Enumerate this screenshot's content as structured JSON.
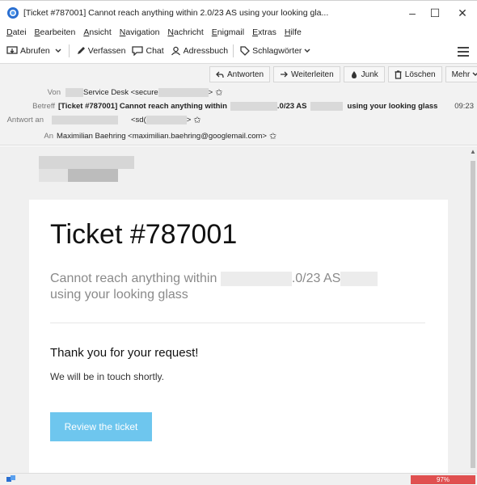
{
  "window": {
    "title": "[Ticket #787001] Cannot reach anything within           2.0/23 AS           using your looking gla...",
    "minimize": "–",
    "maximize": "☐",
    "close": "✕"
  },
  "menu": [
    "Datei",
    "Bearbeiten",
    "Ansicht",
    "Navigation",
    "Nachricht",
    "Enigmail",
    "Extras",
    "Hilfe"
  ],
  "toolbar": {
    "abrufen": "Abrufen",
    "verfassen": "Verfassen",
    "chat": "Chat",
    "adressbuch": "Adressbuch",
    "schlagwoerter": "Schlagwörter"
  },
  "actions": {
    "antworten": "Antworten",
    "weiterleiten": "Weiterleiten",
    "junk": "Junk",
    "loeschen": "Löschen",
    "mehr": "Mehr"
  },
  "headers": {
    "from_label": "Von",
    "from_value_a": "Service Desk <secure",
    "from_value_b": ">",
    "subject_label": "Betreff",
    "subject_a": "[Ticket #787001] Cannot reach anything within",
    "subject_b": ".0/23 AS",
    "subject_c": "using your looking glass",
    "time": "09:23",
    "replyto_label": "Antwort an",
    "replyto_a": "<sd(",
    "replyto_b": ">",
    "to_label": "An",
    "to_value": "Maximilian Baehring <maximilian.baehring@googlemail.com>"
  },
  "email": {
    "ticket_title": "Ticket #787001",
    "subject_part1": "Cannot reach anything within",
    "subject_part2": ".0/23 AS",
    "subject_part3": "using your looking glass",
    "thanks": "Thank you for your request!",
    "touch": "We will be in touch shortly.",
    "review_button": "Review the ticket"
  },
  "status": {
    "progress_text": "97%",
    "progress_value": 97
  },
  "colors": {
    "accent_button": "#6ec6ee",
    "progress": "#e05050"
  }
}
